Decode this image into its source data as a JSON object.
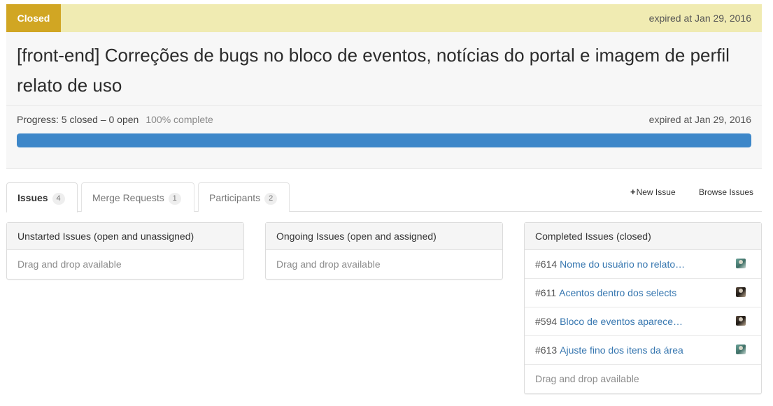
{
  "milestone": {
    "status": "Closed",
    "expired_top": "expired at Jan 29, 2016",
    "title": "[front-end] Correções de bugs no bloco de eventos, notícias do portal e imagem de perfil relato de uso",
    "progress_text": "Progress: 5 closed – 0 open",
    "percent_text": "100% complete",
    "progress_fraction": 1.0,
    "expired_mid": "expired at Jan 29, 2016",
    "colors": {
      "closed_badge": "#d1a623",
      "status_bar": "#f0ebb2",
      "progress": "#3d87c9",
      "link": "#3777b0"
    }
  },
  "tabs": [
    {
      "label": "Issues",
      "count": "4",
      "active": true
    },
    {
      "label": "Merge Requests",
      "count": "1",
      "active": false
    },
    {
      "label": "Participants",
      "count": "2",
      "active": false
    }
  ],
  "actions": {
    "new_issue_icon": "plus-icon",
    "new_issue": "New Issue",
    "browse_issues": "Browse Issues"
  },
  "panels": {
    "unstarted": {
      "title": "Unstarted Issues (open and unassigned)",
      "drag_text": "Drag and drop available"
    },
    "ongoing": {
      "title": "Ongoing Issues (open and assigned)",
      "drag_text": "Drag and drop available"
    },
    "completed": {
      "title": "Completed Issues (closed)",
      "drag_text": "Drag and drop available",
      "issues": [
        {
          "number": "#614",
          "title": "Nome do usuário no relato de uso",
          "avatar": "avatar-teal"
        },
        {
          "number": "#611",
          "title": "Acentos dentro dos selects",
          "avatar": "avatar-dark"
        },
        {
          "number": "#594",
          "title": "Bloco de eventos aparecendo",
          "avatar": "avatar-dark"
        },
        {
          "number": "#613",
          "title": "Ajuste fino dos itens da área",
          "avatar": "avatar-teal"
        }
      ]
    }
  }
}
